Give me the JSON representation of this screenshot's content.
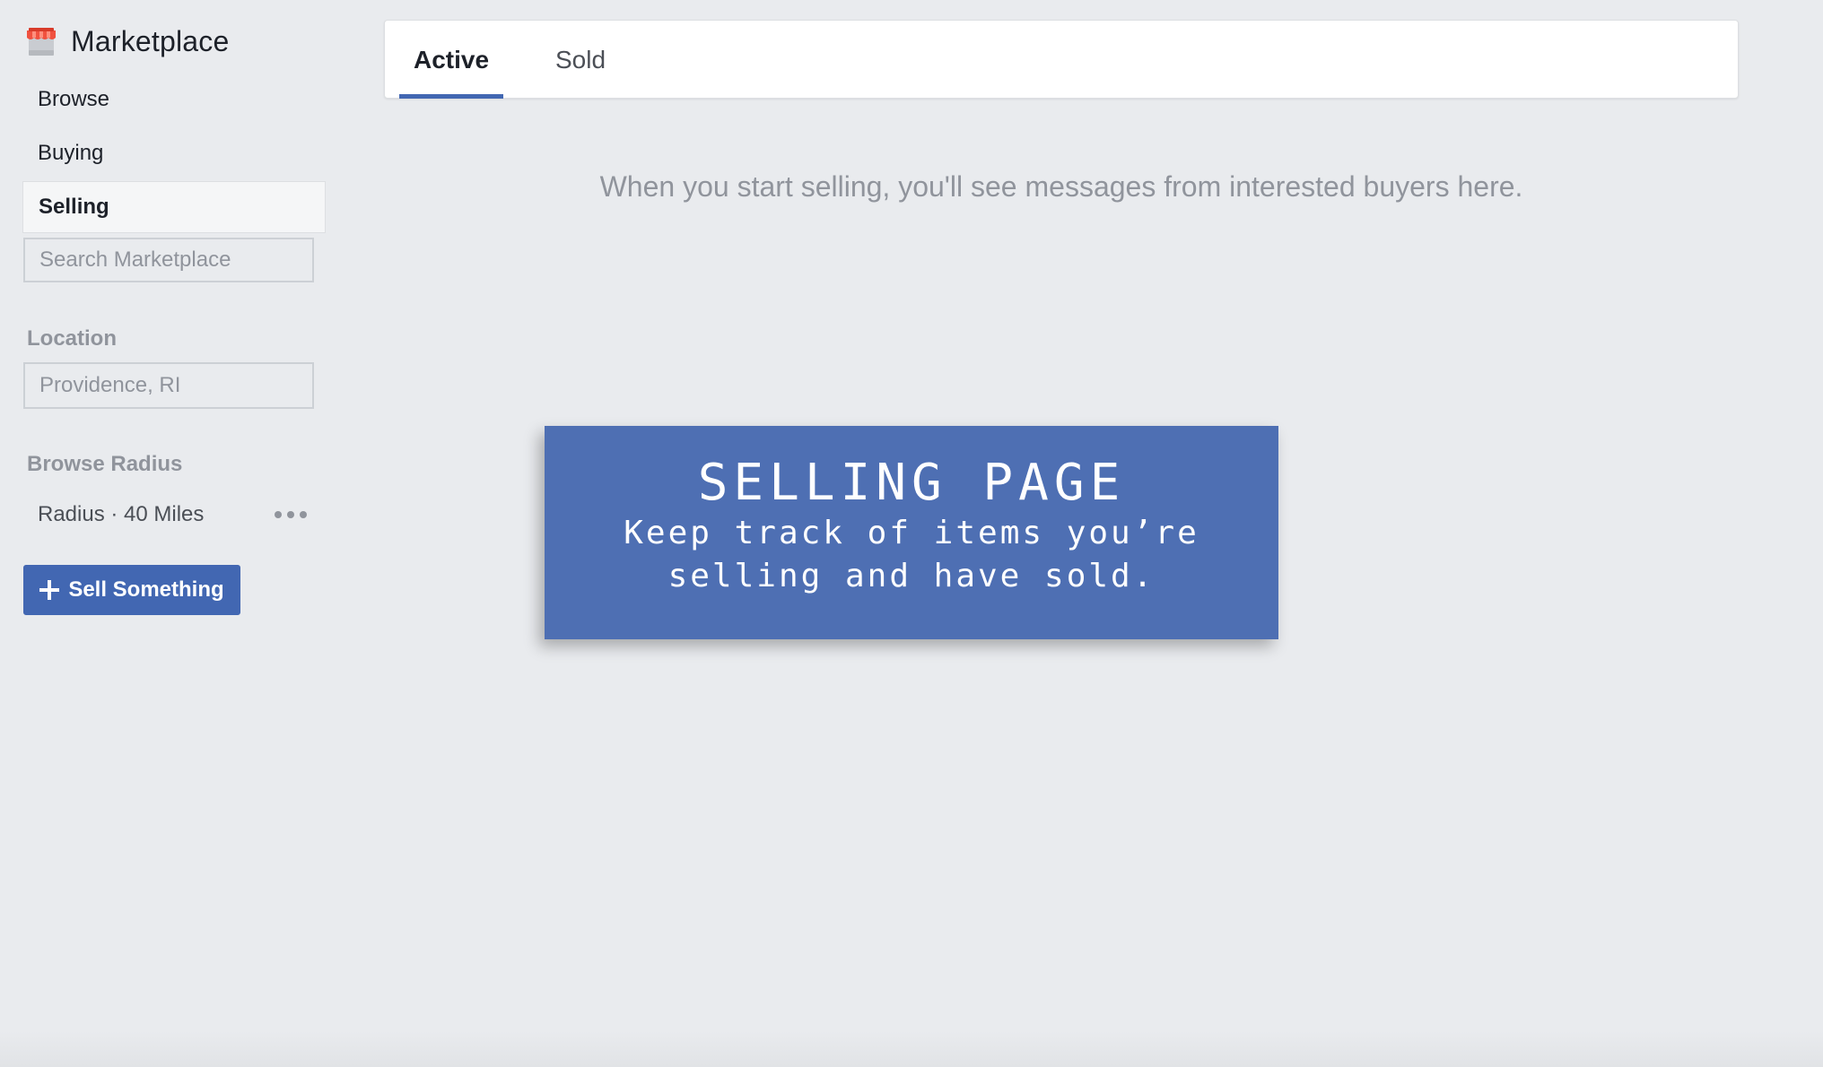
{
  "app": {
    "title": "Marketplace",
    "icon": "storefront-icon",
    "accent_color": "#4267b2"
  },
  "sidebar": {
    "nav_items": [
      {
        "label": "Browse",
        "active": false
      },
      {
        "label": "Buying",
        "active": false
      },
      {
        "label": "Selling",
        "active": true
      }
    ],
    "search": {
      "placeholder": "Search Marketplace",
      "value": "",
      "icon": "search-icon"
    },
    "location": {
      "label": "Location",
      "placeholder": "Providence, RI",
      "value": ""
    },
    "radius": {
      "label": "Browse Radius",
      "value": "Radius · 40 Miles",
      "menu_icon": "more-icon"
    },
    "sell_button": {
      "label": "Sell Something",
      "icon": "plus-icon"
    }
  },
  "main": {
    "tabs": [
      {
        "label": "Active",
        "active": true
      },
      {
        "label": "Sold",
        "active": false
      }
    ],
    "empty_message": "When you start selling, you'll see messages from interested buyers here."
  },
  "banner": {
    "title": "SELLING PAGE",
    "subtitle": "Keep track of items you’re selling and have sold.",
    "background": "#4e6fb3"
  }
}
